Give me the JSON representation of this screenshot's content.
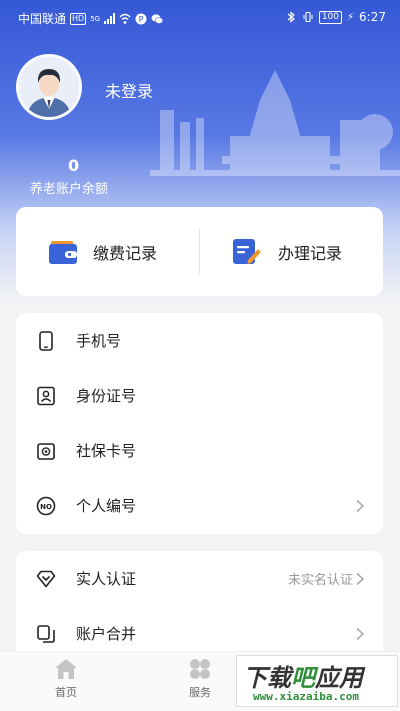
{
  "status_bar": {
    "carrier": "中国联通",
    "hd": "HD",
    "network": "5G",
    "battery": "100",
    "time": "6:27"
  },
  "profile": {
    "login_status": "未登录",
    "balance_value": "0",
    "balance_label": "养老账户余额"
  },
  "records": {
    "payment_label": "缴费记录",
    "handling_label": "办理记录"
  },
  "info_list": [
    {
      "label": "手机号",
      "icon": "phone-icon"
    },
    {
      "label": "身份证号",
      "icon": "id-card-icon"
    },
    {
      "label": "社保卡号",
      "icon": "social-security-card-icon"
    },
    {
      "label": "个人编号",
      "icon": "number-icon"
    }
  ],
  "auth_list": [
    {
      "label": "实人认证",
      "value": "未实名认证",
      "icon": "verify-icon"
    },
    {
      "label": "账户合并",
      "value": "",
      "icon": "merge-icon"
    }
  ],
  "tabbar": {
    "home": "首页",
    "service": "服务"
  },
  "watermark": {
    "brand_part1": "下载",
    "brand_part2": "吧",
    "brand_part3": "应用",
    "site": "www.xiazaiba.com"
  },
  "colors": {
    "brand_blue": "#3558d6",
    "icon_blue": "#3a63d8",
    "icon_orange": "#f0972f"
  }
}
